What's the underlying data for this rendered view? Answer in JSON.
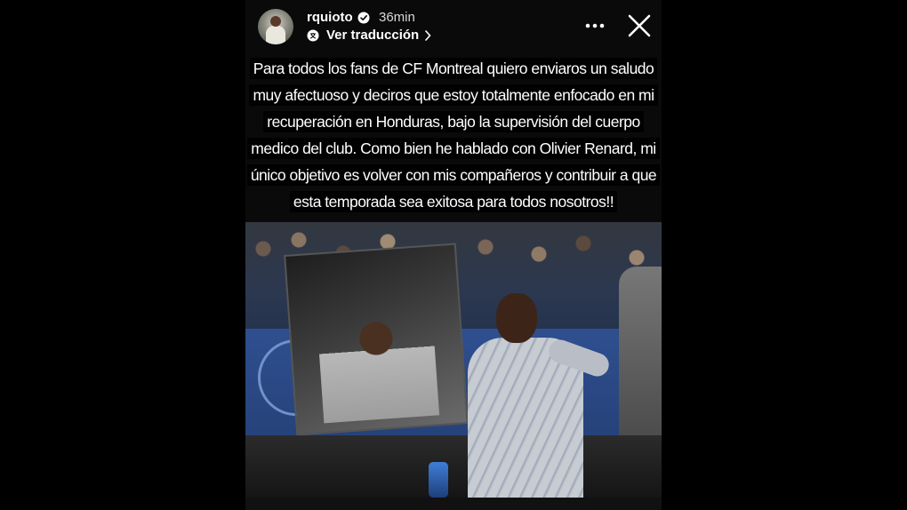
{
  "header": {
    "username": "rquioto",
    "time": "36min",
    "translate_label": "Ver traducción"
  },
  "icons": {
    "verified": "verified-badge-icon",
    "translate": "translate-icon",
    "chevron": "chevron-right-icon",
    "more": "more-options-icon",
    "close": "close-icon"
  },
  "story": {
    "caption": "Para todos los fans de CF Montreal quiero enviaros un saludo muy afectuoso y deciros que estoy totalmente enfocado en mi recuperación en Honduras, bajo la supervisión del cuerpo medico del club. Como bien he hablado con Olivier Renard, mi único objetivo es volver con mis compañeros y contribuir a que esta temporada sea exitosa para todos nosotros!!"
  },
  "colors": {
    "background": "#000000",
    "text": "#ffffff"
  }
}
